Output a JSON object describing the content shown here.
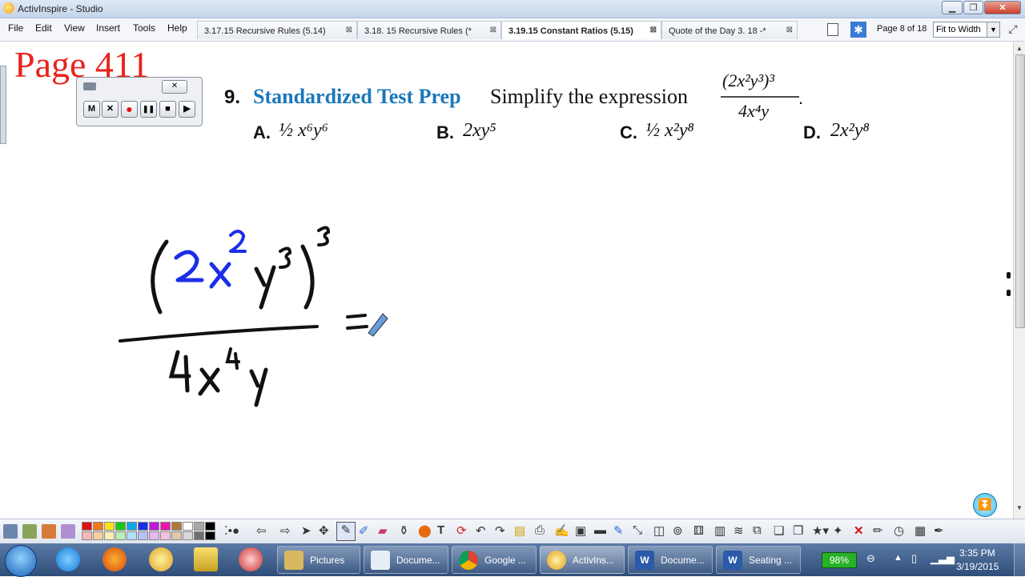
{
  "window": {
    "title": "ActivInspire - Studio"
  },
  "menu": [
    "File",
    "Edit",
    "View",
    "Insert",
    "Tools",
    "Help"
  ],
  "tabs": [
    {
      "label": "3.17.15 Recursive Rules (5.14)",
      "active": false
    },
    {
      "label": "3.18. 15 Recursive Rules (*",
      "active": false
    },
    {
      "label": "3.19.15 Constant Ratios (5.15)",
      "active": true
    },
    {
      "label": "Quote of the Day 3. 18 -*",
      "active": false
    }
  ],
  "page_indicator": "Page 8 of 18",
  "zoom": "Fit to Width",
  "page_heading": "Page 411",
  "recorder": {
    "buttons": [
      "M",
      "✕",
      "●",
      "❚❚",
      "■",
      "▶"
    ]
  },
  "problem": {
    "number": "9.",
    "label": "Standardized Test Prep",
    "text": "Simplify the expression",
    "options": [
      {
        "letter": "A.",
        "expr": "½ x⁶y⁶"
      },
      {
        "letter": "B.",
        "expr": "2xy⁵"
      },
      {
        "letter": "C.",
        "expr": "½ x²y⁸"
      },
      {
        "letter": "D.",
        "expr": "2x²y⁸"
      }
    ]
  },
  "colors": {
    "heading_red": "#e8231b",
    "label_blue": "#1b77b9",
    "ink_blue": "#1a2ee8",
    "ink_black": "#111111"
  },
  "palette": [
    "#e01010",
    "#f07818",
    "#f8e018",
    "#18c818",
    "#10a8e8",
    "#1830e8",
    "#c018d8",
    "#e818a8",
    "#b07838",
    "#ffffff",
    "#a8a8a8",
    "#000000",
    "#f8b8b8",
    "#f8d0a0",
    "#f8f0b0",
    "#b8f0b8",
    "#b0e0f8",
    "#b8c0f8",
    "#e8b8f0",
    "#f8c0e0",
    "#e0c8a8",
    "#d8d8d8",
    "#707070",
    "#000000"
  ],
  "taskbar": {
    "items": [
      "Pictures",
      "Docume...",
      "Google ...",
      "ActivIns...",
      "Docume...",
      "Seating ..."
    ],
    "battery": "98%",
    "time": "3:35 PM",
    "date": "3/19/2015"
  }
}
